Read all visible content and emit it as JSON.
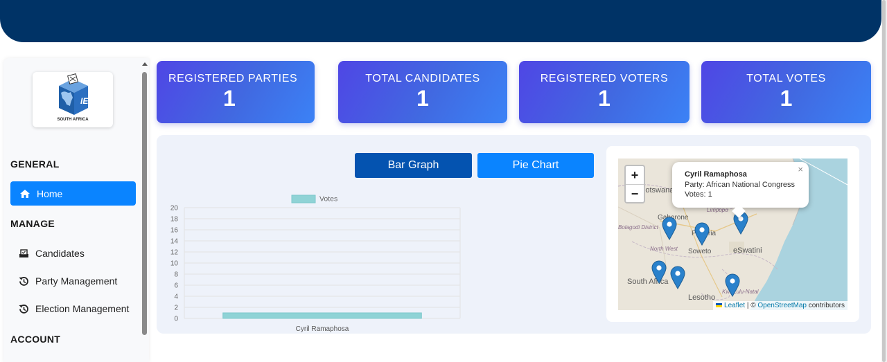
{
  "logo": {
    "text": "IEC",
    "subtext": "SOUTH AFRICA"
  },
  "sidebar": {
    "sections": {
      "general": "GENERAL",
      "manage": "MANAGE",
      "account": "ACCOUNT"
    },
    "home": {
      "label": "Home",
      "icon": "home-icon"
    },
    "items": [
      {
        "label": "Candidates",
        "icon": "ballot-icon"
      },
      {
        "label": "Party Management",
        "icon": "history-icon"
      },
      {
        "label": "Election Management",
        "icon": "history-icon"
      }
    ]
  },
  "stats": [
    {
      "title": "REGISTERED PARTIES",
      "value": "1"
    },
    {
      "title": "TOTAL CANDIDATES",
      "value": "1"
    },
    {
      "title": "REGISTERED VOTERS",
      "value": "1"
    },
    {
      "title": "TOTAL VOTES",
      "value": "1"
    }
  ],
  "buttons": {
    "bar_graph": "Bar Graph",
    "pie_chart": "Pie Chart"
  },
  "chart_data": {
    "type": "bar",
    "categories": [
      "Cyril Ramaphosa"
    ],
    "series": [
      {
        "name": "Votes",
        "values": [
          1
        ]
      }
    ],
    "ylim": [
      0,
      20
    ],
    "yticks": [
      0,
      2,
      4,
      6,
      8,
      10,
      12,
      14,
      16,
      18,
      20
    ],
    "grid": true,
    "legend": "top",
    "colors": {
      "bar_fill": "#8fd3d6",
      "bar_stroke": "#7cc8cc"
    }
  },
  "map": {
    "zoom_in": "+",
    "zoom_out": "−",
    "labels": [
      "Botswana",
      "Gaborone",
      "Pretoria",
      "Soweto",
      "eSwatini",
      "North West",
      "South Africa",
      "Lesotho",
      "Limpopo",
      "Bolagodi District",
      "KwaZulu-Natal"
    ],
    "popup": {
      "name": "Cyril Ramaphosa",
      "party": "Party: African National Congress",
      "votes": "Votes: 1",
      "close": "×"
    },
    "attribution": {
      "leaflet": "Leaflet",
      "sep": " | © ",
      "osm": "OpenStreetMap",
      "suffix": " contributors"
    }
  },
  "colors": {
    "header": "#003366",
    "primary": "#0a84ff",
    "active_button": "#0453b0",
    "card_gradient_start": "#4f46e5",
    "card_gradient_end": "#3b82f6",
    "panel": "#eef2fa"
  }
}
